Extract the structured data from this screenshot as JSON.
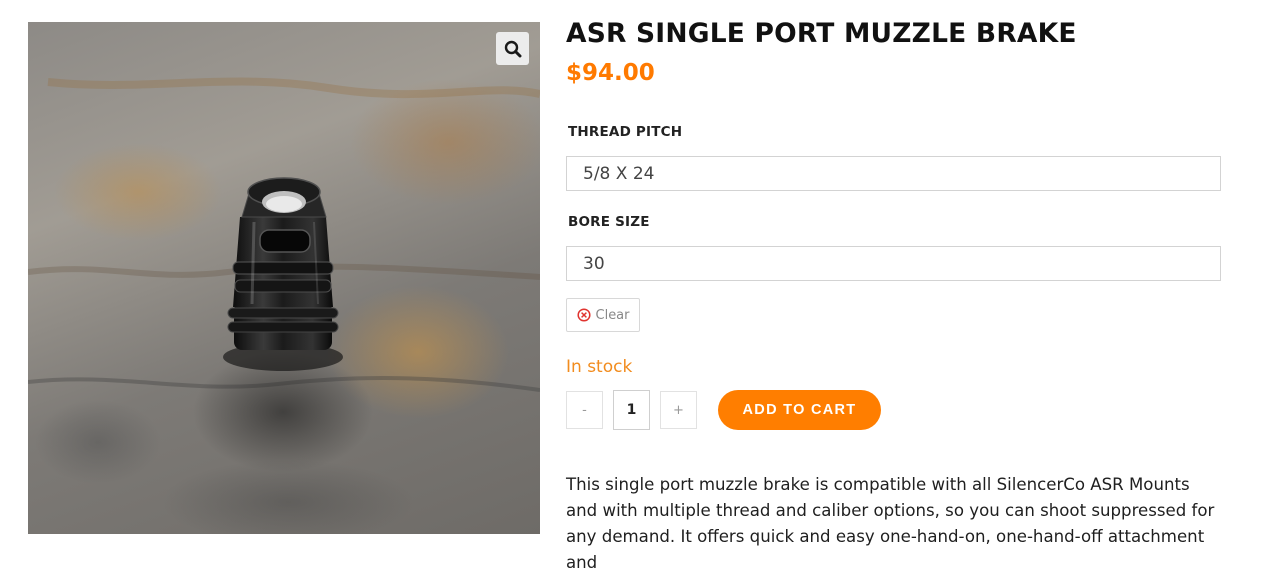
{
  "product": {
    "title": "ASR SINGLE PORT MUZZLE BRAKE",
    "price": "$94.00",
    "image_alt": "muzzle-brake-photo"
  },
  "icons": {
    "zoom": "magnifier-icon",
    "clear": "circle-x-icon"
  },
  "variations": {
    "thread_pitch": {
      "label": "THREAD PITCH",
      "value": "5/8 X 24"
    },
    "bore_size": {
      "label": "BORE SIZE",
      "value": "30"
    },
    "clear_label": "Clear"
  },
  "stock": {
    "status": "In stock"
  },
  "cart": {
    "minus": "-",
    "quantity": "1",
    "plus": "+",
    "add_label": "ADD TO CART"
  },
  "description": "This single port muzzle brake is compatible with all SilencerCo ASR Mounts and with multiple thread and caliber options, so you can shoot suppressed for any demand. It offers quick and easy one-hand-on, one-hand-off attachment and",
  "colors": {
    "accent": "#ff7e00",
    "price": "#ff7a00",
    "stock": "#f28c1e",
    "clear_icon": "#e0342f"
  }
}
